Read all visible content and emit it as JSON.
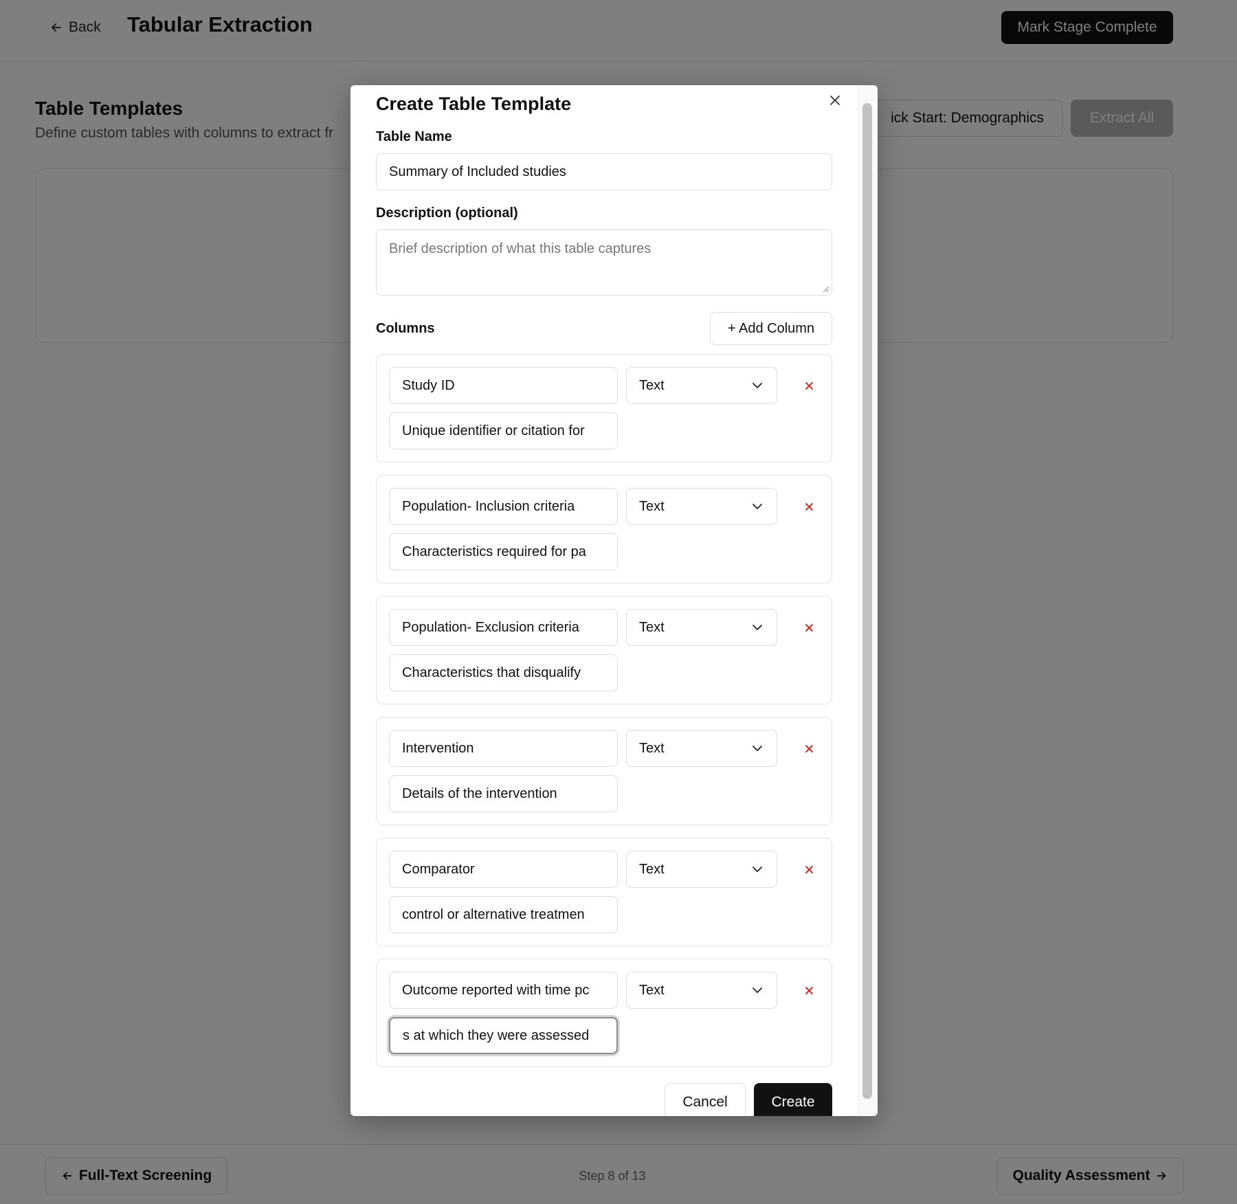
{
  "header": {
    "back_label": "Back",
    "title": "Tabular Extraction",
    "mark_complete_label": "Mark Stage Complete"
  },
  "templates": {
    "title": "Table Templates",
    "subtitle": "Define custom tables with columns to extract fr",
    "quick_start_label": "ick Start: Demographics",
    "extract_all_label": "Extract All"
  },
  "footer": {
    "prev_label": "Full-Text Screening",
    "step_text": "Step 8 of 13",
    "next_label": "Quality Assessment"
  },
  "modal": {
    "title": "Create Table Template",
    "table_name_label": "Table Name",
    "table_name_value": "Summary of Included studies",
    "description_label": "Description (optional)",
    "description_placeholder": "Brief description of what this table captures",
    "columns_label": "Columns",
    "add_column_label": "+ Add Column",
    "cancel_label": "Cancel",
    "create_label": "Create",
    "columns": [
      {
        "name": "Study ID",
        "type": "Text",
        "description": "Unique identifier or citation for"
      },
      {
        "name": "Population- Inclusion criteria",
        "type": "Text",
        "description": "Characteristics required for pa"
      },
      {
        "name": "Population- Exclusion criteria",
        "type": "Text",
        "description": "Characteristics that disqualify"
      },
      {
        "name": "Intervention",
        "type": "Text",
        "description": "Details of the intervention"
      },
      {
        "name": "Comparator",
        "type": "Text",
        "description": "control or alternative treatmen"
      },
      {
        "name": "Outcome reported with time pc",
        "type": "Text",
        "description": "s at which they were assessed"
      }
    ]
  },
  "icons": {
    "back": "arrow-left-icon",
    "close": "close-icon",
    "dropdown": "chevron-down-icon",
    "delete": "x-icon",
    "prev": "arrow-left-icon",
    "next": "arrow-right-icon"
  },
  "colors": {
    "primary": "#111111",
    "delete": "#d32f2f",
    "overlay": "rgba(0,0,0,0.5)"
  }
}
